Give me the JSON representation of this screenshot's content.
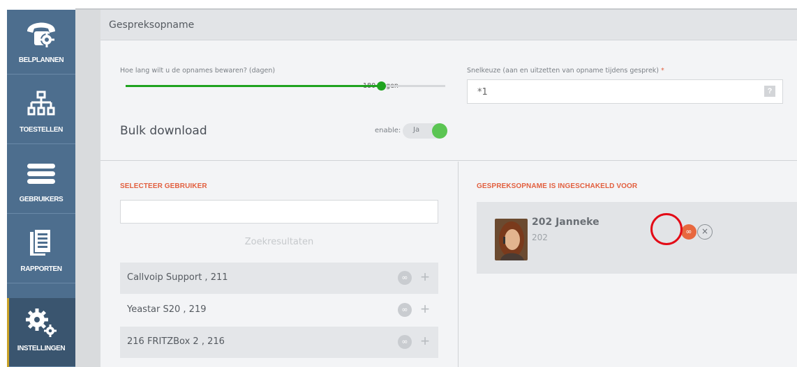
{
  "sidebar": {
    "items": [
      {
        "label": "BELPLANNEN",
        "icon": "phone-settings-icon"
      },
      {
        "label": "TOESTELLEN",
        "icon": "network-tree-icon"
      },
      {
        "label": "GEBRUIKERS",
        "icon": "users-list-icon"
      },
      {
        "label": "RAPPORTEN",
        "icon": "report-document-icon"
      },
      {
        "label": "INSTELLINGEN",
        "icon": "gears-icon"
      }
    ],
    "active": "INSTELLINGEN"
  },
  "panel": {
    "title": "Gespreksopname",
    "retention_label": "Hoe lang wilt u de opnames bewaren? (dagen)",
    "retention_value": "180 dagen",
    "retention_fraction": 0.8,
    "shortcut_label": "Snelkeuze (aan en uitzetten van opname tijdens gesprek)",
    "shortcut_required": "*",
    "shortcut_value": "*1",
    "shortcut_help": "?",
    "bulk_title": "Bulk download",
    "enable_label": "enable:",
    "toggle_text": "Ja",
    "toggle_on": true
  },
  "select_user": {
    "heading": "SELECTEER GEBRUIKER",
    "search_placeholder": "",
    "results_label": "Zoekresultaten",
    "results": [
      {
        "name": "Callvoip Support , 211"
      },
      {
        "name": "Yeastar S20 , 219"
      },
      {
        "name": "216 FRITZBox 2 , 216"
      }
    ]
  },
  "enabled_for": {
    "heading": "GESPREKSOPNAME IS INGESCHAKELD VOOR",
    "users": [
      {
        "name": "202 Janneke",
        "extension": "202"
      }
    ]
  },
  "icons": {
    "record": "∞",
    "add": "+",
    "remove": "×"
  },
  "colors": {
    "sidebar": "#4d6e8e",
    "accent_green": "#1fa31f",
    "heading_orange": "#e25f3f",
    "record_active": "#e8683f",
    "highlight_red": "#e30b17"
  }
}
